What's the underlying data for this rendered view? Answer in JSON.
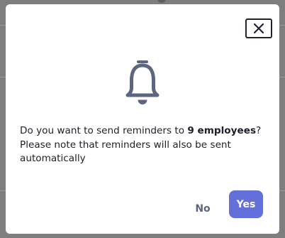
{
  "dialog": {
    "message_prefix": "Do you want to send reminders to ",
    "message_emphasis": "9 employees",
    "message_suffix": "? Please note that reminders will also be sent automatically",
    "no_label": "No",
    "yes_label": "Yes",
    "icons": {
      "close": "close-icon",
      "bell": "bell-icon"
    }
  },
  "colors": {
    "primary": "#6470d9",
    "secondary_text": "#5d6680",
    "icon": "#5d6680",
    "text": "#1e2029",
    "backdrop": "#7e7e7e"
  }
}
